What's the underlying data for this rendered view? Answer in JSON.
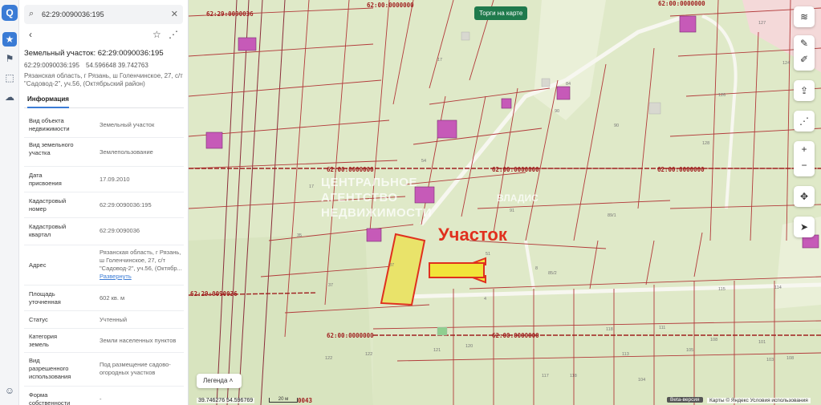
{
  "rail": {
    "logo": "Q",
    "icons": [
      "star-icon",
      "flag-icon",
      "select-icon",
      "cloud-icon",
      "user-icon"
    ]
  },
  "search": {
    "value": "62:29:0090036:195"
  },
  "parcel": {
    "title": "Земельный участок: 62:29:0090036:195",
    "number": "62:29:0090036:195",
    "coords": "54.596648 39.742763",
    "address": "Рязанская область, г Рязань, ш Голенчинское, 27, с/т \"Садовод-2\", уч.56, (Октябрьский район)"
  },
  "tabs": {
    "info": "Информация"
  },
  "rows": [
    {
      "label": "Вид объекта недвижимости",
      "value": "Земельный участок"
    },
    {
      "label": "Вид земельного участка",
      "value": "Землепользование"
    },
    {
      "label": "Дата присвоения",
      "value": "17.09.2010"
    },
    {
      "label": "Кадастровый номер",
      "value": "62:29:0090036:195"
    },
    {
      "label": "Кадастровый квартал",
      "value": "62:29:0090036"
    },
    {
      "label": "Адрес",
      "value": "Рязанская область, г Рязань, ш Голенчинское, 27, с/т \"Садовод-2\", уч.56, (Октябр...",
      "link": "Развернуть"
    },
    {
      "label": "Площадь уточненная",
      "value": "602 кв. м"
    },
    {
      "label": "Статус",
      "value": "Учтенный"
    },
    {
      "label": "Категория земель",
      "value": "Земли населенных пунктов"
    },
    {
      "label": "Вид разрешенного использования",
      "value": "Под размещение садово-огородных участков"
    },
    {
      "label": "Форма собственности",
      "value": "-"
    }
  ],
  "map": {
    "torgi": "Торги на карте",
    "annotation": "Участок",
    "watermark_left": [
      "ЦЕНТРАЛЬНОЕ",
      "АГЕНТСТВО",
      "НЕДВИЖИМОСТИ"
    ],
    "watermark_right": "ВЛАДИС",
    "cad_labels": [
      "62:29:0090036",
      "62:00:0000000",
      "62:00:0000000",
      "62:00:0000000",
      "62:00:0000000",
      "62:00:0000000",
      "62:29:0090036",
      "62:00:0000000",
      "62:00:0000000",
      "0043"
    ],
    "legend": "Легенда",
    "coords": "39.746276  54.596769",
    "scale": "20 м",
    "beta": "Beta-версия",
    "copyright": "Карты © Яндекс   Условия использования"
  },
  "colors": {
    "accent": "#3a7bd5",
    "parcel": "#e9e36a",
    "highlight": "#e0301e",
    "building": "#c65ab8",
    "boundary": "#b23a3a"
  }
}
